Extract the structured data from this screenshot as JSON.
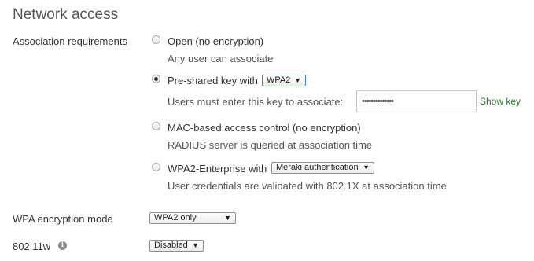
{
  "section": {
    "title": "Network access"
  },
  "association": {
    "label": "Association requirements",
    "options": [
      {
        "label": "Open (no encryption)",
        "desc": "Any user can associate",
        "checked": false
      },
      {
        "label": "Pre-shared key with",
        "select_value": "WPA2",
        "desc": "Users must enter this key to associate:",
        "key_value": "••••••••••••••",
        "show_key": "Show key",
        "checked": true
      },
      {
        "label": "MAC-based access control (no encryption)",
        "desc": "RADIUS server is queried at association time",
        "checked": false
      },
      {
        "label": "WPA2-Enterprise with",
        "select_value": "Meraki authentication",
        "desc": "User credentials are validated with 802.1X at association time",
        "checked": false
      }
    ]
  },
  "wpa_mode": {
    "label": "WPA encryption mode",
    "value": "WPA2 only"
  },
  "dot11w": {
    "label": "802.11w",
    "value": "Disabled",
    "info_icon": "info-icon"
  }
}
